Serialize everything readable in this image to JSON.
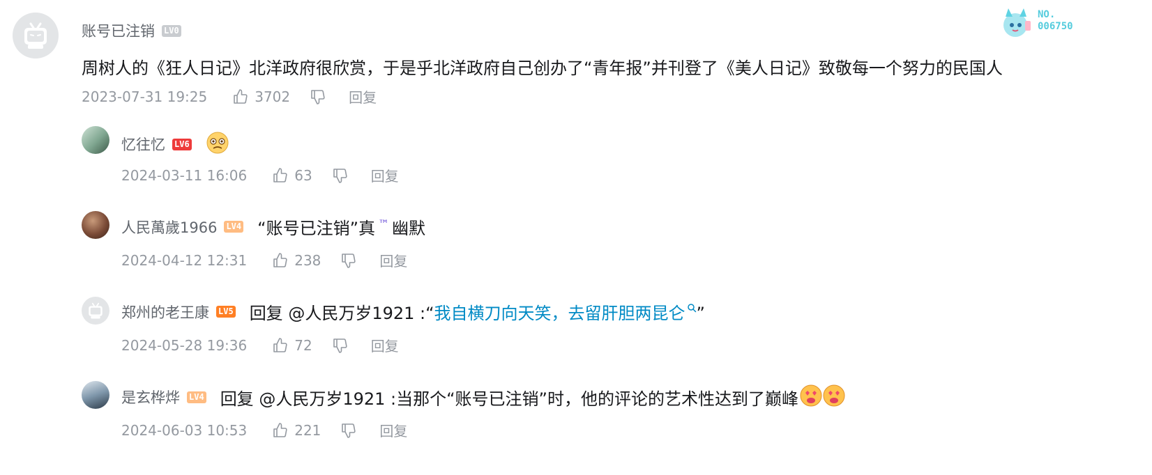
{
  "badge": {
    "line1": "NO.",
    "line2": "006750"
  },
  "main_comment": {
    "username": "账号已注销",
    "level": "LV0",
    "text": "周树人的《狂人日记》北洋政府很欣赏，于是乎北洋政府自己创办了“青年报”并刊登了《美人日记》致敬每一个努力的民国人",
    "time": "2023-07-31 19:25",
    "likes": "3702",
    "reply_label": "回复"
  },
  "replies": [
    {
      "username": "忆往忆",
      "level": "LV6",
      "text": "",
      "emoji": "worried-face",
      "time": "2024-03-11 16:06",
      "likes": "63",
      "reply_label": "回复"
    },
    {
      "username": "人民萬歲1966",
      "level": "LV4",
      "text": "“账号已注销”真",
      "tm": "™",
      "text_after": "幽默",
      "time": "2024-04-12 12:31",
      "likes": "238",
      "reply_label": "回复"
    },
    {
      "username": "郑州的老王康",
      "level": "LV5",
      "text_prefix": "回复 @人民万岁1921 :“",
      "link_text": "我自横刀向天笑，去留肝胆两昆仑",
      "text_suffix": "”",
      "time": "2024-05-28 19:36",
      "likes": "72",
      "reply_label": "回复"
    },
    {
      "username": "是玄桦烨",
      "level": "LV4",
      "text": "回复 @人民万岁1921 :当那个“账号已注销”时，他的评论的艺术性达到了巅峰",
      "emoji": "heart-eyes-face",
      "time": "2024-06-03 10:53",
      "likes": "221",
      "reply_label": "回复"
    }
  ],
  "colors": {
    "text": "#18191c",
    "meta": "#9499a0",
    "link": "#008ac5",
    "badge": "#55ccdd"
  }
}
